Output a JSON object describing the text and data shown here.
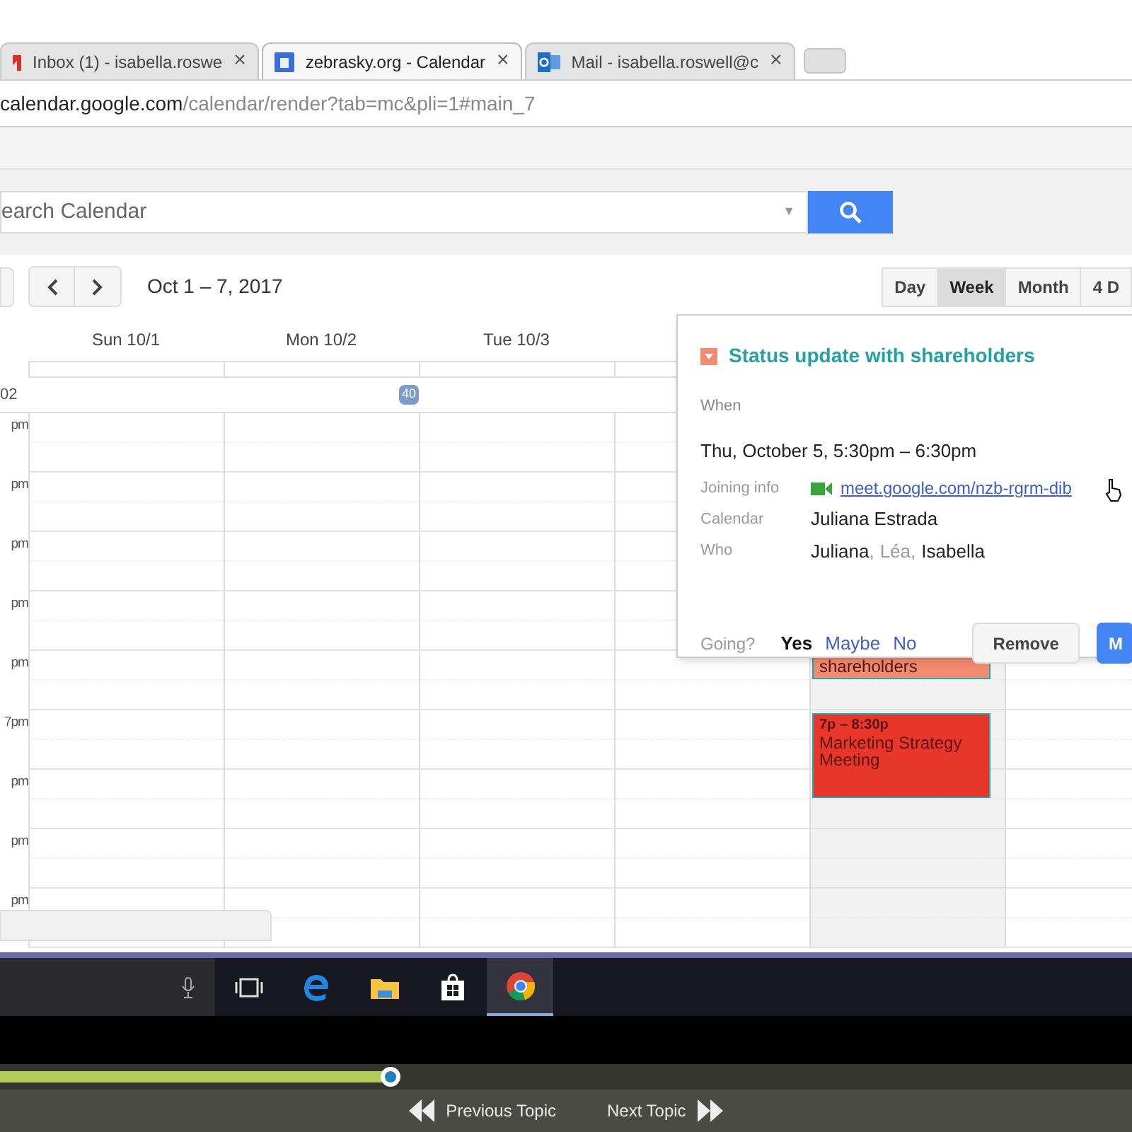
{
  "browser": {
    "tabs": [
      {
        "title": "Inbox (1) - isabella.roswe",
        "close": "×",
        "selected": false
      },
      {
        "title": "zebrasky.org - Calendar",
        "close": "×",
        "selected": true
      },
      {
        "title": "Mail - isabella.roswell@c",
        "close": "×",
        "selected": false
      }
    ],
    "url": {
      "domain": "calendar.google.com",
      "path": "/calendar/render?tab=mc&pli=1#main_7"
    }
  },
  "search": {
    "placeholder": "earch Calendar",
    "dropdown": "▼"
  },
  "toolbar": {
    "date_range": "Oct 1 – 7, 2017",
    "views": [
      {
        "label": "Day",
        "selected": false
      },
      {
        "label": "Week",
        "selected": true
      },
      {
        "label": "Month",
        "selected": false
      },
      {
        "label": "4 D",
        "selected": false
      }
    ]
  },
  "calendar": {
    "week_label": "02",
    "week_badge": "40",
    "days": [
      {
        "label": "Sun 10/1",
        "today": false
      },
      {
        "label": "Mon 10/2",
        "today": false
      },
      {
        "label": "Tue 10/3",
        "today": false
      },
      {
        "today": false
      },
      {
        "today": true
      },
      {
        "today": false
      }
    ],
    "hours": [
      "pm",
      "pm",
      "pm",
      "pm",
      "pm",
      "7pm",
      "pm",
      "pm",
      "pm"
    ],
    "events": [
      {
        "title": "shareholders",
        "color": "#f28b6f"
      },
      {
        "time": "7p – 8:30p",
        "title": "Marketing Strategy Meeting",
        "color": "#e8362b"
      }
    ]
  },
  "popup": {
    "title": "Status update with shareholders",
    "color": "#f28b6f",
    "when_label": "When",
    "when": "Thu, October 5, 5:30pm – 6:30pm",
    "joining_label": "Joining info",
    "joining_link": "meet.google.com/nzb-rgrm-dib",
    "calendar_label": "Calendar",
    "calendar": "Juliana Estrada",
    "who_label": "Who",
    "who": [
      {
        "name": "Juliana",
        "separator": ",",
        "accepted": true
      },
      {
        "name": "Léa",
        "separator": ",",
        "accepted": false
      },
      {
        "name": "Isabella",
        "accepted": true
      }
    ],
    "going_label": "Going?",
    "going": [
      {
        "label": "Yes",
        "selected": true
      },
      {
        "label": "Maybe",
        "selected": false
      },
      {
        "label": "No",
        "selected": false
      }
    ],
    "buttons": [
      {
        "label": "Remove",
        "kind": "secondary"
      },
      {
        "label": "M",
        "kind": "primary"
      }
    ]
  },
  "player": {
    "level": 0.345,
    "previous": "Previous Topic",
    "next": "Next Topic"
  }
}
